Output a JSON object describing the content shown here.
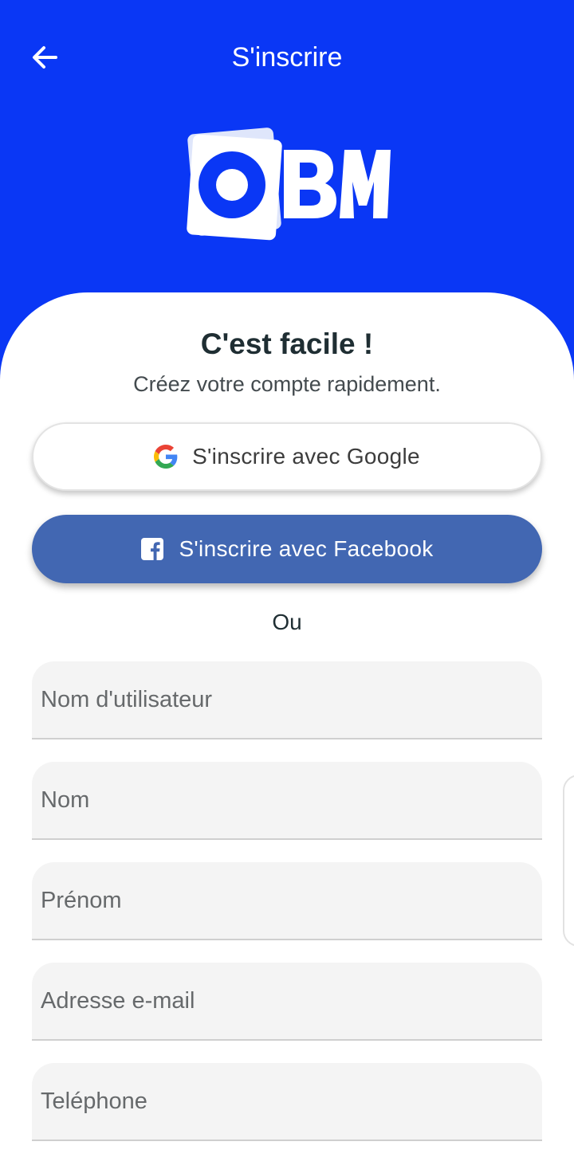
{
  "header": {
    "title": "S'inscrire",
    "back_icon": "arrow-left-icon",
    "brand_color": "#0a37f5"
  },
  "logo": {
    "text": "OBM"
  },
  "intro": {
    "headline": "C'est facile !",
    "subline": "Créez votre compte rapidement."
  },
  "social": {
    "google_label": "S'inscrire avec Google",
    "google_icon": "google-icon",
    "facebook_label": "S'inscrire avec Facebook",
    "facebook_icon": "facebook-icon",
    "facebook_color": "#4267b2"
  },
  "separator": "Ou",
  "form": {
    "fields": [
      {
        "placeholder": "Nom d'utilisateur",
        "value": ""
      },
      {
        "placeholder": "Nom",
        "value": ""
      },
      {
        "placeholder": "Prénom",
        "value": ""
      },
      {
        "placeholder": "Adresse e-mail",
        "value": ""
      },
      {
        "placeholder": "Teléphone",
        "value": ""
      }
    ]
  }
}
